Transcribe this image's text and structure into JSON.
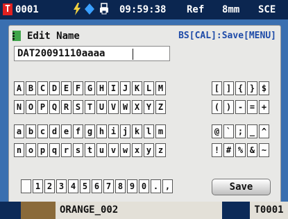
{
  "status": {
    "t_badge": "T",
    "id": "0001",
    "time": "09:59:38",
    "ref": "Ref",
    "aperture": "8mm",
    "mode": "SCE"
  },
  "dialog": {
    "title": "Edit Name",
    "hint": "BS[CAL]:Save[MENU]",
    "input_value": "DAT20091110aaaa",
    "save_label": "Save"
  },
  "keyboard": {
    "upper_row1": [
      "A",
      "B",
      "C",
      "D",
      "E",
      "F",
      "G",
      "H",
      "I",
      "J",
      "K",
      "L",
      "M"
    ],
    "upper_row2": [
      "N",
      "O",
      "P",
      "Q",
      "R",
      "S",
      "T",
      "U",
      "V",
      "W",
      "X",
      "Y",
      "Z"
    ],
    "lower_row1": [
      "a",
      "b",
      "c",
      "d",
      "e",
      "f",
      "g",
      "h",
      "i",
      "j",
      "k",
      "l",
      "m"
    ],
    "lower_row2": [
      "n",
      "o",
      "p",
      "q",
      "r",
      "s",
      "t",
      "u",
      "v",
      "w",
      "x",
      "y",
      "z"
    ],
    "number_row": [
      " ",
      "1",
      "2",
      "3",
      "4",
      "5",
      "6",
      "7",
      "8",
      "9",
      "0",
      ".",
      ","
    ],
    "sym_row1": [
      "[",
      "]",
      "{",
      "}",
      "$"
    ],
    "sym_row2": [
      "(",
      ")",
      "-",
      "=",
      "+"
    ],
    "sym_row3": [
      "@",
      "`",
      ";",
      "_",
      "^"
    ],
    "sym_row4": [
      "!",
      "#",
      "%",
      "&",
      "~"
    ]
  },
  "footer": {
    "sample_name": "ORANGE_002",
    "target": "T0001"
  },
  "colors": {
    "status_bg": "#0b2650",
    "band_bg": "#3a6fb0",
    "dialog_bg": "#e8e8e6",
    "hint_blue": "#1d4aa8",
    "badge_red": "#e02020",
    "battery_yellow": "#f0d040",
    "usb_blue": "#3aa0ff",
    "footer_swatch": "#8a6a3a"
  }
}
